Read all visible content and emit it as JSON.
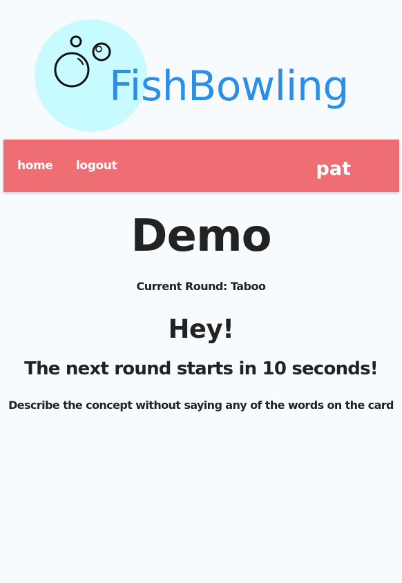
{
  "logo": {
    "text": "FishBowling",
    "icon": "bubbles-icon",
    "text_color": "#2b8fe8",
    "circle_color": "#c8fbff"
  },
  "nav": {
    "background": "#ef6e73",
    "home_label": "home",
    "logout_label": "logout",
    "username": "pat"
  },
  "game": {
    "title": "Demo",
    "current_round": "Current Round: Taboo",
    "greeting": "Hey!",
    "countdown": "The next round starts in 10 seconds!",
    "instructions": "Describe the concept without saying any of the words on the card"
  }
}
